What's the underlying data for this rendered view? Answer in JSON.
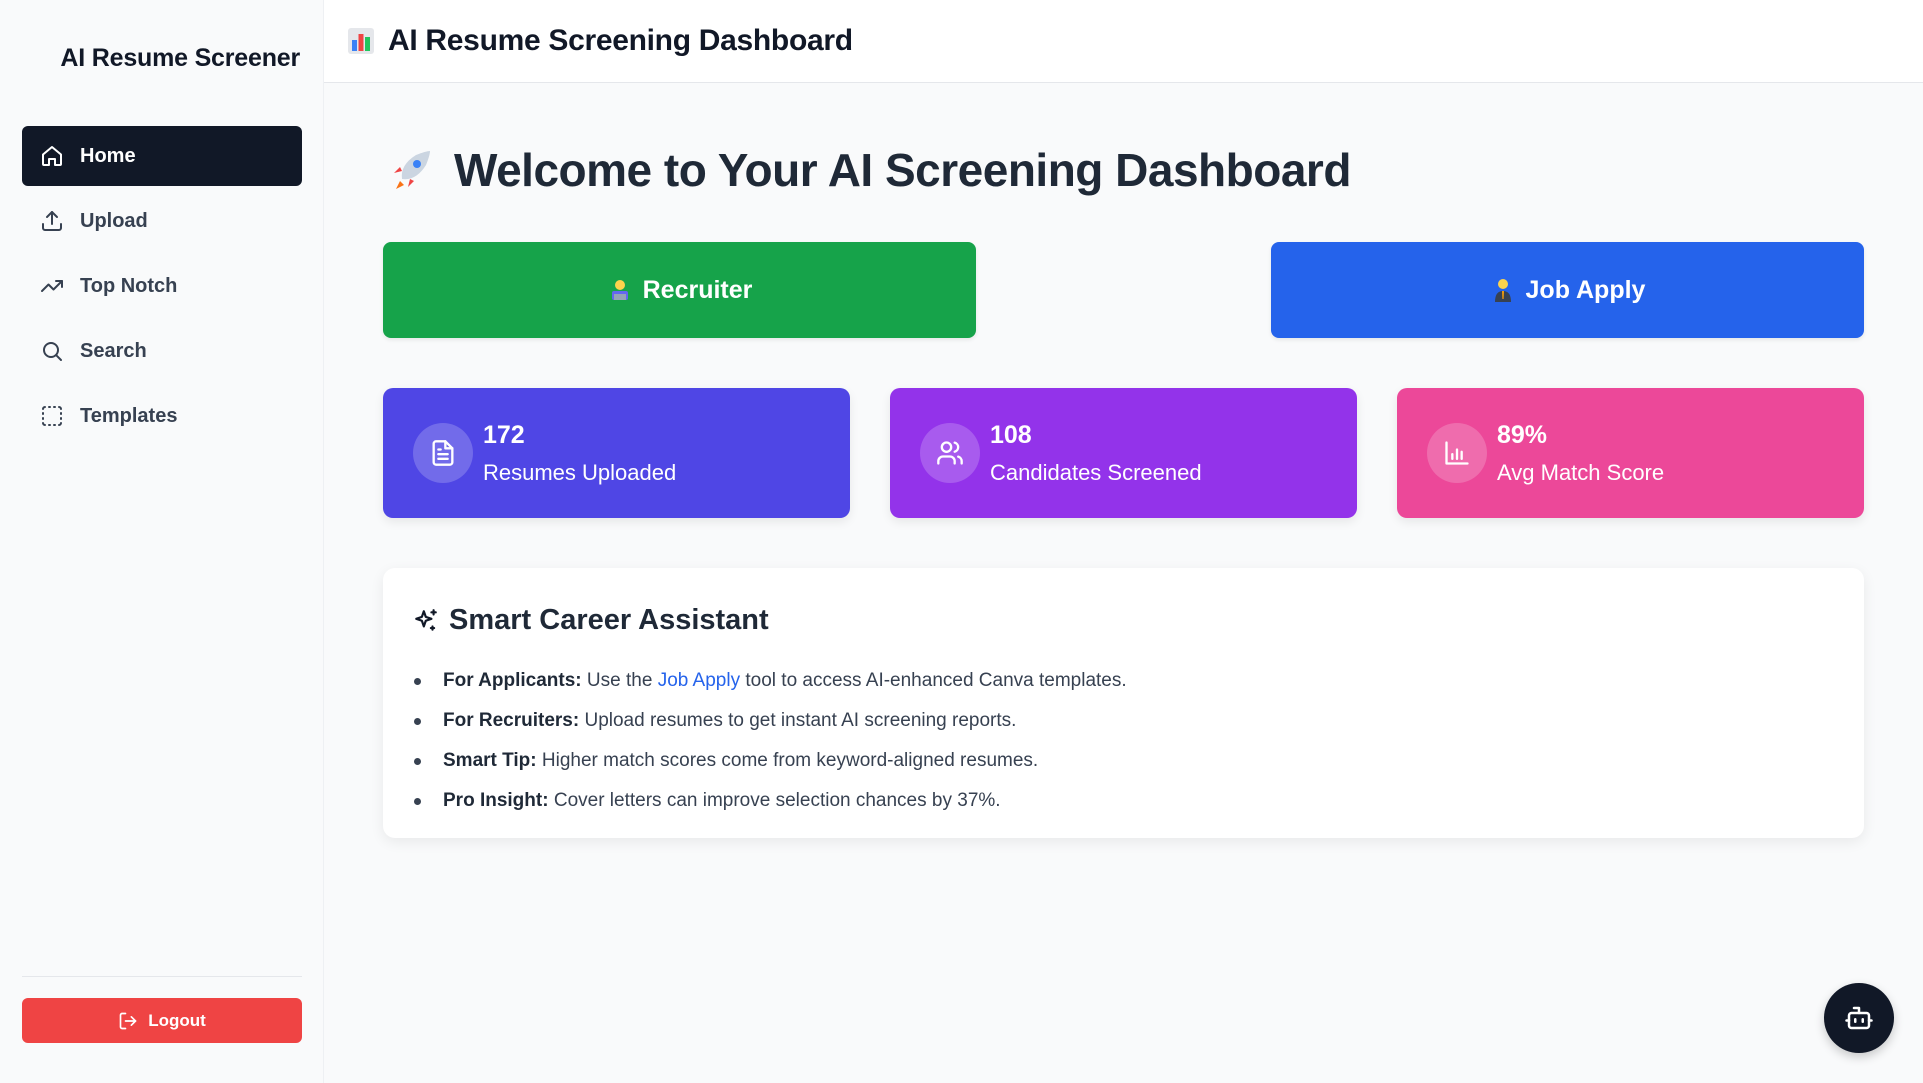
{
  "sidebar": {
    "brand": "AI Resume Screener",
    "items": [
      {
        "label": "Home",
        "icon": "home-icon",
        "active": true
      },
      {
        "label": "Upload",
        "icon": "upload-icon",
        "active": false
      },
      {
        "label": "Top Notch",
        "icon": "trending-up-icon",
        "active": false
      },
      {
        "label": "Search",
        "icon": "search-icon",
        "active": false
      },
      {
        "label": "Templates",
        "icon": "dashed-square-icon",
        "active": false
      }
    ],
    "logout_label": "Logout"
  },
  "header": {
    "title": "AI Resume Screening Dashboard",
    "icon": "bar-chart-emoji-icon"
  },
  "main": {
    "welcome": "Welcome to Your AI Screening Dashboard",
    "welcome_icon": "rocket-emoji-icon",
    "buttons": {
      "recruiter": "Recruiter",
      "job_apply": "Job Apply"
    },
    "stats": [
      {
        "value": "172",
        "label": "Resumes Uploaded",
        "icon": "file-icon",
        "color": "#4f46e5"
      },
      {
        "value": "108",
        "label": "Candidates Screened",
        "icon": "users-icon",
        "color": "#9333ea"
      },
      {
        "value": "89%",
        "label": "Avg Match Score",
        "icon": "bar-chart-icon",
        "color": "#ec4899"
      }
    ],
    "assistant": {
      "title": "Smart Career Assistant",
      "tips": [
        {
          "bold": "For Applicants:",
          "pre": " Use the ",
          "link": "Job Apply",
          "post": " tool to access AI-enhanced Canva templates."
        },
        {
          "bold": "For Recruiters:",
          "text": " Upload resumes to get instant AI screening reports."
        },
        {
          "bold": "Smart Tip:",
          "text": " Higher match scores come from keyword-aligned resumes."
        },
        {
          "bold": "Pro Insight:",
          "text": " Cover letters can improve selection chances by 37%."
        }
      ]
    }
  },
  "colors": {
    "recruiter": "#16a34a",
    "job_apply": "#2563eb",
    "logout": "#ef4444",
    "active_nav": "#111827"
  }
}
